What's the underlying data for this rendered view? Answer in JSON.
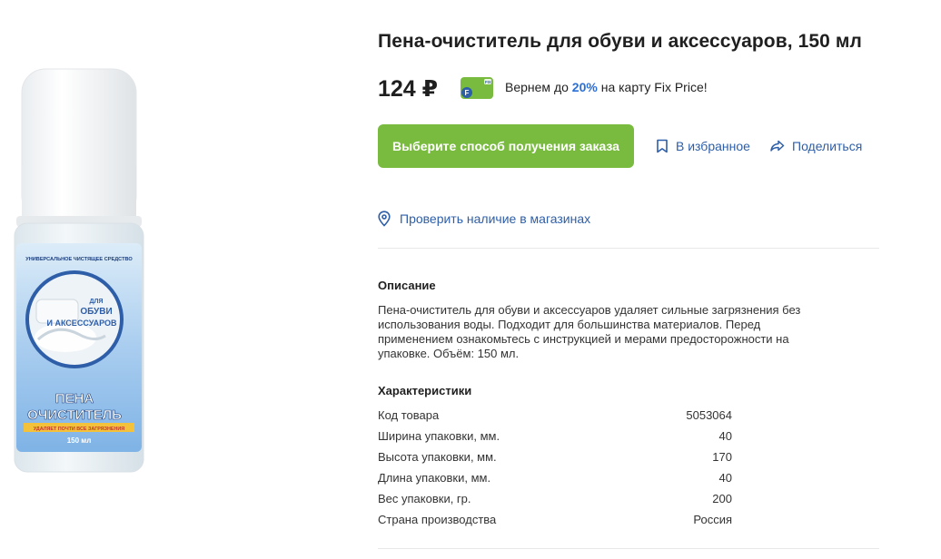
{
  "product": {
    "title": "Пена-очиститель для обуви и аксессуаров, 150 мл",
    "price": "124 ₽",
    "image_label": {
      "top_line": "УНИВЕРСАЛЬНОЕ ЧИСТЯЩЕЕ СРЕДСТВО",
      "for": "ДЛЯ",
      "line1": "ОБУВИ",
      "line2": "И АКСЕССУАРОВ",
      "name1": "ПЕНА",
      "name2": "ОЧИСТИТЕЛЬ",
      "tagline": "УДАЛЯЕТ ПОЧТИ ВСЕ ЗАГРЯЗНЕНИЯ",
      "volume": "150 мл"
    }
  },
  "loyalty": {
    "card_text": "FIX",
    "card_letter": "F",
    "prefix": "Вернем до ",
    "percent": "20%",
    "suffix": " на карту Fix Price!"
  },
  "actions": {
    "order_button": "Выберите способ получения заказа",
    "favorites": "В избранное",
    "share": "Поделиться",
    "check_stock": "Проверить наличие в магазинах"
  },
  "description": {
    "title": "Описание",
    "text": "Пена-очиститель для обуви и аксессуаров удаляет сильные загрязнения без использования воды. Подходит для большинства материалов. Перед применением ознакомьтесь с инструкцией и мерами предосторожности на упаковке. Объём: 150 мл."
  },
  "characteristics": {
    "title": "Характеристики",
    "rows": [
      {
        "key": "Код товара",
        "value": "5053064"
      },
      {
        "key": "Ширина упаковки, мм.",
        "value": "40"
      },
      {
        "key": "Высота упаковки, мм.",
        "value": "170"
      },
      {
        "key": "Длина упаковки, мм.",
        "value": "40"
      },
      {
        "key": "Вес упаковки, гр.",
        "value": "200"
      },
      {
        "key": "Страна производства",
        "value": "Россия"
      }
    ]
  },
  "colors": {
    "accent_green": "#79bb3f",
    "link_blue": "#2d5ea8",
    "percent_blue": "#2b6fd6"
  },
  "icons": {
    "favorites": "bookmark-icon",
    "share": "share-arrow-icon",
    "check_stock": "location-pin-icon",
    "loyalty": "fix-price-card-icon"
  }
}
